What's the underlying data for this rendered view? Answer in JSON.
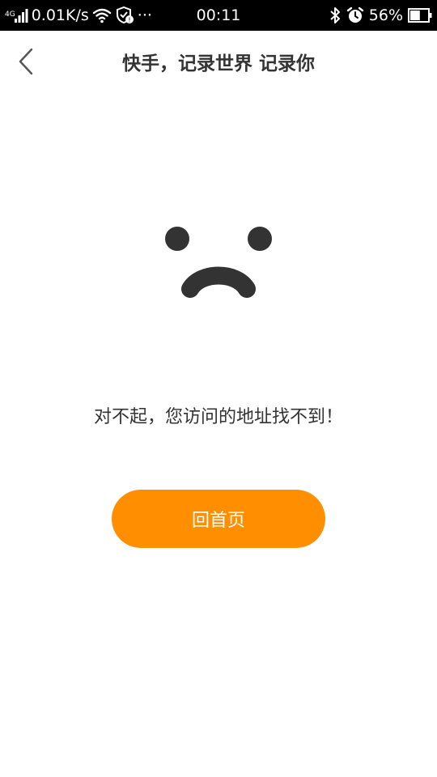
{
  "status_bar": {
    "network_type": "4G",
    "speed": "0.01K/s",
    "more": "···",
    "time": "00:11",
    "battery": "56%",
    "battery_level": 0.56
  },
  "nav": {
    "title": "快手，记录世界 记录你"
  },
  "error": {
    "message": "对不起，您访问的地址找不到！"
  },
  "actions": {
    "home_label": "回首页"
  },
  "colors": {
    "accent": "#ff8f00",
    "text": "#333333",
    "status_bar_bg": "#000000"
  },
  "icons": {
    "back": "chevron-left-icon",
    "signal": "signal-icon",
    "wifi": "wifi-icon",
    "shield": "shield-check-icon",
    "bluetooth": "bluetooth-icon",
    "alarm": "alarm-icon",
    "battery": "battery-icon"
  }
}
